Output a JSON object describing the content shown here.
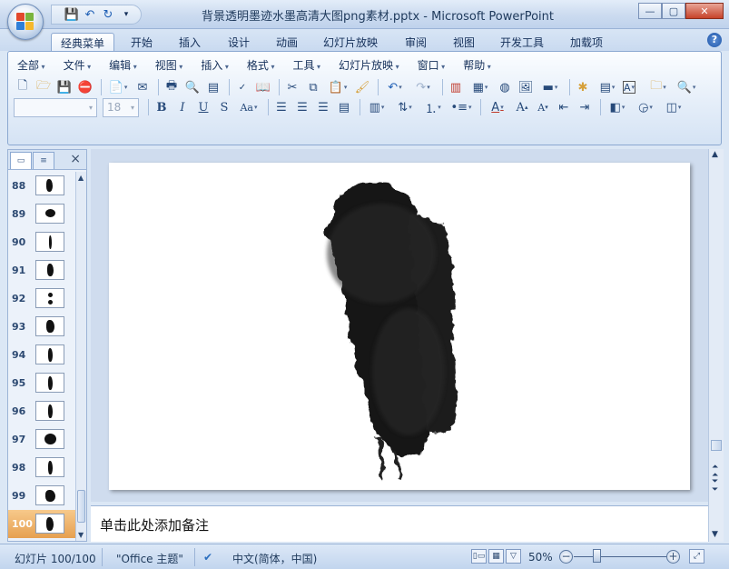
{
  "window": {
    "title": "背景透明墨迹水墨高清大图png素材.pptx - Microsoft PowerPoint",
    "controls": [
      "minimize-icon",
      "maximize-icon",
      "close-icon"
    ]
  },
  "quick_access": [
    "save-icon",
    "undo-icon",
    "redo-icon",
    "customize-icon"
  ],
  "tabs": [
    "经典菜单",
    "开始",
    "插入",
    "设计",
    "动画",
    "幻灯片放映",
    "审阅",
    "视图",
    "开发工具",
    "加载项"
  ],
  "active_tab": "经典菜单",
  "menubar": [
    "全部",
    "文件",
    "编辑",
    "视图",
    "插入",
    "格式",
    "工具",
    "幻灯片放映",
    "窗口",
    "帮助"
  ],
  "toolbar": {
    "font_name": "",
    "font_size": "18",
    "row1_icons": [
      "new-icon",
      "open-icon",
      "save-icon",
      "permission-icon",
      "print-preview-icon",
      "email-icon",
      "print-icon",
      "preview-icon",
      "outline-icon",
      "spellcheck-icon",
      "research-icon",
      "cut-icon",
      "copy-icon",
      "paste-icon",
      "format-painter-icon",
      "undo-icon",
      "redo-icon",
      "chart-icon",
      "table-icon",
      "smartart-icon",
      "picture-icon",
      "color-grayscale-icon",
      "new-slide-icon",
      "layout-icon",
      "textbox-icon",
      "folder-icon",
      "zoom-icon"
    ],
    "row2_icons": [
      "bold-icon",
      "italic-icon",
      "underline-icon",
      "shadow-icon",
      "change-case-icon",
      "align-left-icon",
      "align-center-icon",
      "align-right-icon",
      "justify-icon",
      "columns-icon",
      "text-direction-icon",
      "bullets-icon",
      "numbering-icon",
      "font-color-icon",
      "grow-font-icon",
      "shrink-font-icon",
      "decrease-indent-icon",
      "increase-indent-icon",
      "shape-fill-icon",
      "shape-outline-icon",
      "arrange-icon"
    ]
  },
  "slides_panel": {
    "tabs": [
      "slides-tab-icon",
      "outline-tab-icon"
    ],
    "close": "×",
    "thumbnails": [
      "88",
      "89",
      "90",
      "91",
      "92",
      "93",
      "94",
      "95",
      "96",
      "97",
      "98",
      "99",
      "100"
    ],
    "selected": "100"
  },
  "notes_placeholder": "单击此处添加备注",
  "status": {
    "slide": "幻灯片 100/100",
    "theme": "\"Office 主题\"",
    "language": "中文(简体，中国)",
    "zoom": "50%",
    "view_buttons": [
      "normal-view-icon",
      "slide-sorter-icon",
      "slideshow-icon"
    ]
  },
  "colors": {
    "accent_blue": "#15305a",
    "ribbon": "#dbe7f5",
    "selected_thumb": "#e6a050",
    "ink": "#111111"
  }
}
